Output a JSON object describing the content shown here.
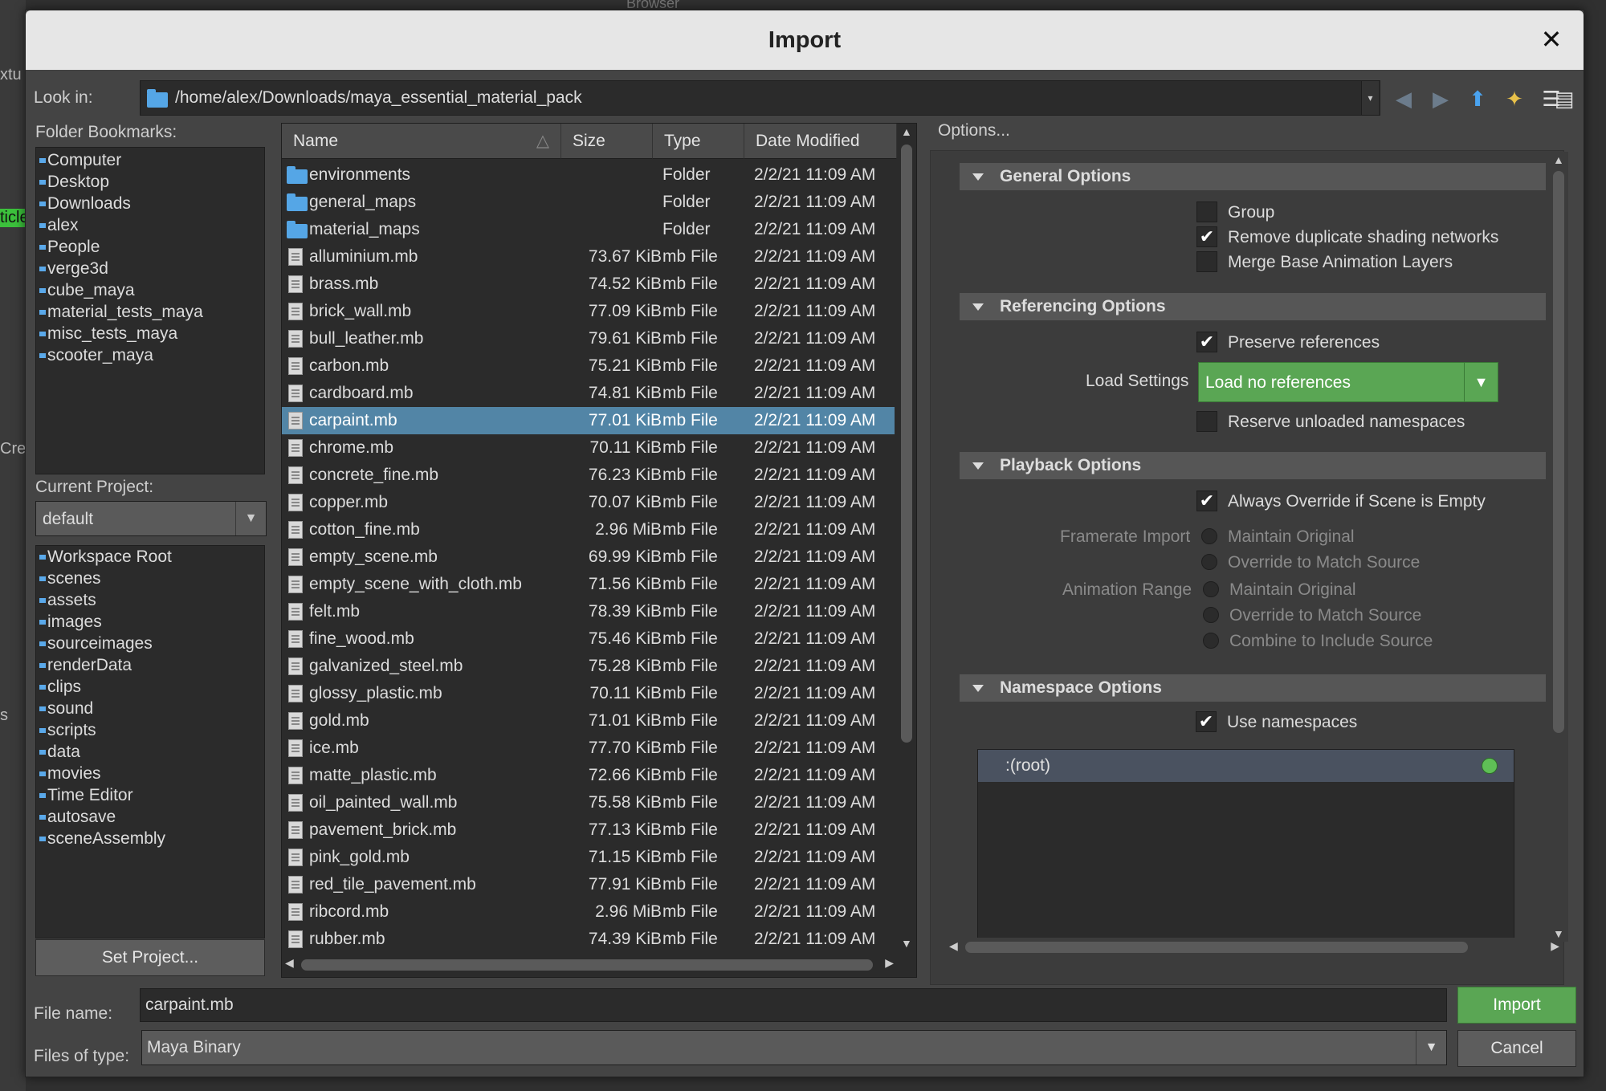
{
  "window": {
    "title": "Import",
    "background_title": "Browser"
  },
  "background_fragments": [
    "xtu",
    "ticle",
    "Cre",
    "s"
  ],
  "look_in": {
    "label": "Look in:",
    "path": "/home/alex/Downloads/maya_essential_material_pack"
  },
  "toolbar_icons": [
    "back-icon",
    "forward-icon",
    "up-folder-icon",
    "new-folder-icon",
    "list-view-icon",
    "detail-view-icon"
  ],
  "bookmarks": {
    "label": "Folder Bookmarks:",
    "items": [
      "Computer",
      "Desktop",
      "Downloads",
      "alex",
      "People",
      "verge3d",
      "cube_maya",
      "material_tests_maya",
      "misc_tests_maya",
      "scooter_maya"
    ]
  },
  "project": {
    "label": "Current Project:",
    "value": "default",
    "items": [
      "Workspace Root",
      "scenes",
      "assets",
      "images",
      "sourceimages",
      "renderData",
      "clips",
      "sound",
      "scripts",
      "data",
      "movies",
      "Time Editor",
      "autosave",
      "sceneAssembly"
    ],
    "set_button": "Set Project..."
  },
  "file_table": {
    "headers": {
      "name": "Name",
      "size": "Size",
      "type": "Type",
      "date": "Date Modified"
    },
    "rows": [
      {
        "name": "environments",
        "size": "",
        "type": "Folder",
        "date": "2/2/21 11:09 AM",
        "kind": "folder"
      },
      {
        "name": "general_maps",
        "size": "",
        "type": "Folder",
        "date": "2/2/21 11:09 AM",
        "kind": "folder"
      },
      {
        "name": "material_maps",
        "size": "",
        "type": "Folder",
        "date": "2/2/21 11:09 AM",
        "kind": "folder"
      },
      {
        "name": "alluminium.mb",
        "size": "73.67 KiB",
        "type": "mb File",
        "date": "2/2/21 11:09 AM",
        "kind": "file"
      },
      {
        "name": "brass.mb",
        "size": "74.52 KiB",
        "type": "mb File",
        "date": "2/2/21 11:09 AM",
        "kind": "file"
      },
      {
        "name": "brick_wall.mb",
        "size": "77.09 KiB",
        "type": "mb File",
        "date": "2/2/21 11:09 AM",
        "kind": "file"
      },
      {
        "name": "bull_leather.mb",
        "size": "79.61 KiB",
        "type": "mb File",
        "date": "2/2/21 11:09 AM",
        "kind": "file"
      },
      {
        "name": "carbon.mb",
        "size": "75.21 KiB",
        "type": "mb File",
        "date": "2/2/21 11:09 AM",
        "kind": "file"
      },
      {
        "name": "cardboard.mb",
        "size": "74.81 KiB",
        "type": "mb File",
        "date": "2/2/21 11:09 AM",
        "kind": "file"
      },
      {
        "name": "carpaint.mb",
        "size": "77.01 KiB",
        "type": "mb File",
        "date": "2/2/21 11:09 AM",
        "kind": "file",
        "selected": true
      },
      {
        "name": "chrome.mb",
        "size": "70.11 KiB",
        "type": "mb File",
        "date": "2/2/21 11:09 AM",
        "kind": "file"
      },
      {
        "name": "concrete_fine.mb",
        "size": "76.23 KiB",
        "type": "mb File",
        "date": "2/2/21 11:09 AM",
        "kind": "file"
      },
      {
        "name": "copper.mb",
        "size": "70.07 KiB",
        "type": "mb File",
        "date": "2/2/21 11:09 AM",
        "kind": "file"
      },
      {
        "name": "cotton_fine.mb",
        "size": "2.96 MiB",
        "type": "mb File",
        "date": "2/2/21 11:09 AM",
        "kind": "file"
      },
      {
        "name": "empty_scene.mb",
        "size": "69.99 KiB",
        "type": "mb File",
        "date": "2/2/21 11:09 AM",
        "kind": "file"
      },
      {
        "name": "empty_scene_with_cloth.mb",
        "size": "71.56 KiB",
        "type": "mb File",
        "date": "2/2/21 11:09 AM",
        "kind": "file"
      },
      {
        "name": "felt.mb",
        "size": "78.39 KiB",
        "type": "mb File",
        "date": "2/2/21 11:09 AM",
        "kind": "file"
      },
      {
        "name": "fine_wood.mb",
        "size": "75.46 KiB",
        "type": "mb File",
        "date": "2/2/21 11:09 AM",
        "kind": "file"
      },
      {
        "name": "galvanized_steel.mb",
        "size": "75.28 KiB",
        "type": "mb File",
        "date": "2/2/21 11:09 AM",
        "kind": "file"
      },
      {
        "name": "glossy_plastic.mb",
        "size": "70.11 KiB",
        "type": "mb File",
        "date": "2/2/21 11:09 AM",
        "kind": "file"
      },
      {
        "name": "gold.mb",
        "size": "71.01 KiB",
        "type": "mb File",
        "date": "2/2/21 11:09 AM",
        "kind": "file"
      },
      {
        "name": "ice.mb",
        "size": "77.70 KiB",
        "type": "mb File",
        "date": "2/2/21 11:09 AM",
        "kind": "file"
      },
      {
        "name": "matte_plastic.mb",
        "size": "72.66 KiB",
        "type": "mb File",
        "date": "2/2/21 11:09 AM",
        "kind": "file"
      },
      {
        "name": "oil_painted_wall.mb",
        "size": "75.58 KiB",
        "type": "mb File",
        "date": "2/2/21 11:09 AM",
        "kind": "file"
      },
      {
        "name": "pavement_brick.mb",
        "size": "77.13 KiB",
        "type": "mb File",
        "date": "2/2/21 11:09 AM",
        "kind": "file"
      },
      {
        "name": "pink_gold.mb",
        "size": "71.15 KiB",
        "type": "mb File",
        "date": "2/2/21 11:09 AM",
        "kind": "file"
      },
      {
        "name": "red_tile_pavement.mb",
        "size": "77.91 KiB",
        "type": "mb File",
        "date": "2/2/21 11:09 AM",
        "kind": "file"
      },
      {
        "name": "ribcord.mb",
        "size": "2.96 MiB",
        "type": "mb File",
        "date": "2/2/21 11:09 AM",
        "kind": "file"
      },
      {
        "name": "rubber.mb",
        "size": "74.39 KiB",
        "type": "mb File",
        "date": "2/2/21 11:09 AM",
        "kind": "file"
      }
    ]
  },
  "options": {
    "label": "Options...",
    "general": {
      "title": "General Options",
      "group": {
        "label": "Group",
        "checked": false
      },
      "remove_dup": {
        "label": "Remove duplicate shading networks",
        "checked": true
      },
      "merge_base": {
        "label": "Merge Base Animation Layers",
        "checked": false
      }
    },
    "referencing": {
      "title": "Referencing Options",
      "preserve": {
        "label": "Preserve references",
        "checked": true
      },
      "load_settings_label": "Load Settings",
      "load_settings_value": "Load no references",
      "reserve": {
        "label": "Reserve unloaded namespaces",
        "checked": false
      }
    },
    "playback": {
      "title": "Playback Options",
      "always_override": {
        "label": "Always Override if Scene is Empty",
        "checked": true
      },
      "framerate_label": "Framerate Import",
      "framerate_options": [
        "Maintain Original",
        "Override to Match Source"
      ],
      "anim_range_label": "Animation Range",
      "anim_range_options": [
        "Maintain Original",
        "Override to Match Source",
        "Combine to Include Source"
      ]
    },
    "namespace": {
      "title": "Namespace Options",
      "use_ns": {
        "label": "Use namespaces",
        "checked": true
      },
      "root": ":(root)"
    }
  },
  "footer": {
    "file_name_label": "File name:",
    "file_name_value": "carpaint.mb",
    "file_type_label": "Files of type:",
    "file_type_value": "Maya Binary",
    "import_button": "Import",
    "cancel_button": "Cancel"
  },
  "colors": {
    "accent_green": "#5aa654",
    "selection_blue": "#5285a6",
    "folder_blue": "#55a6e6"
  }
}
